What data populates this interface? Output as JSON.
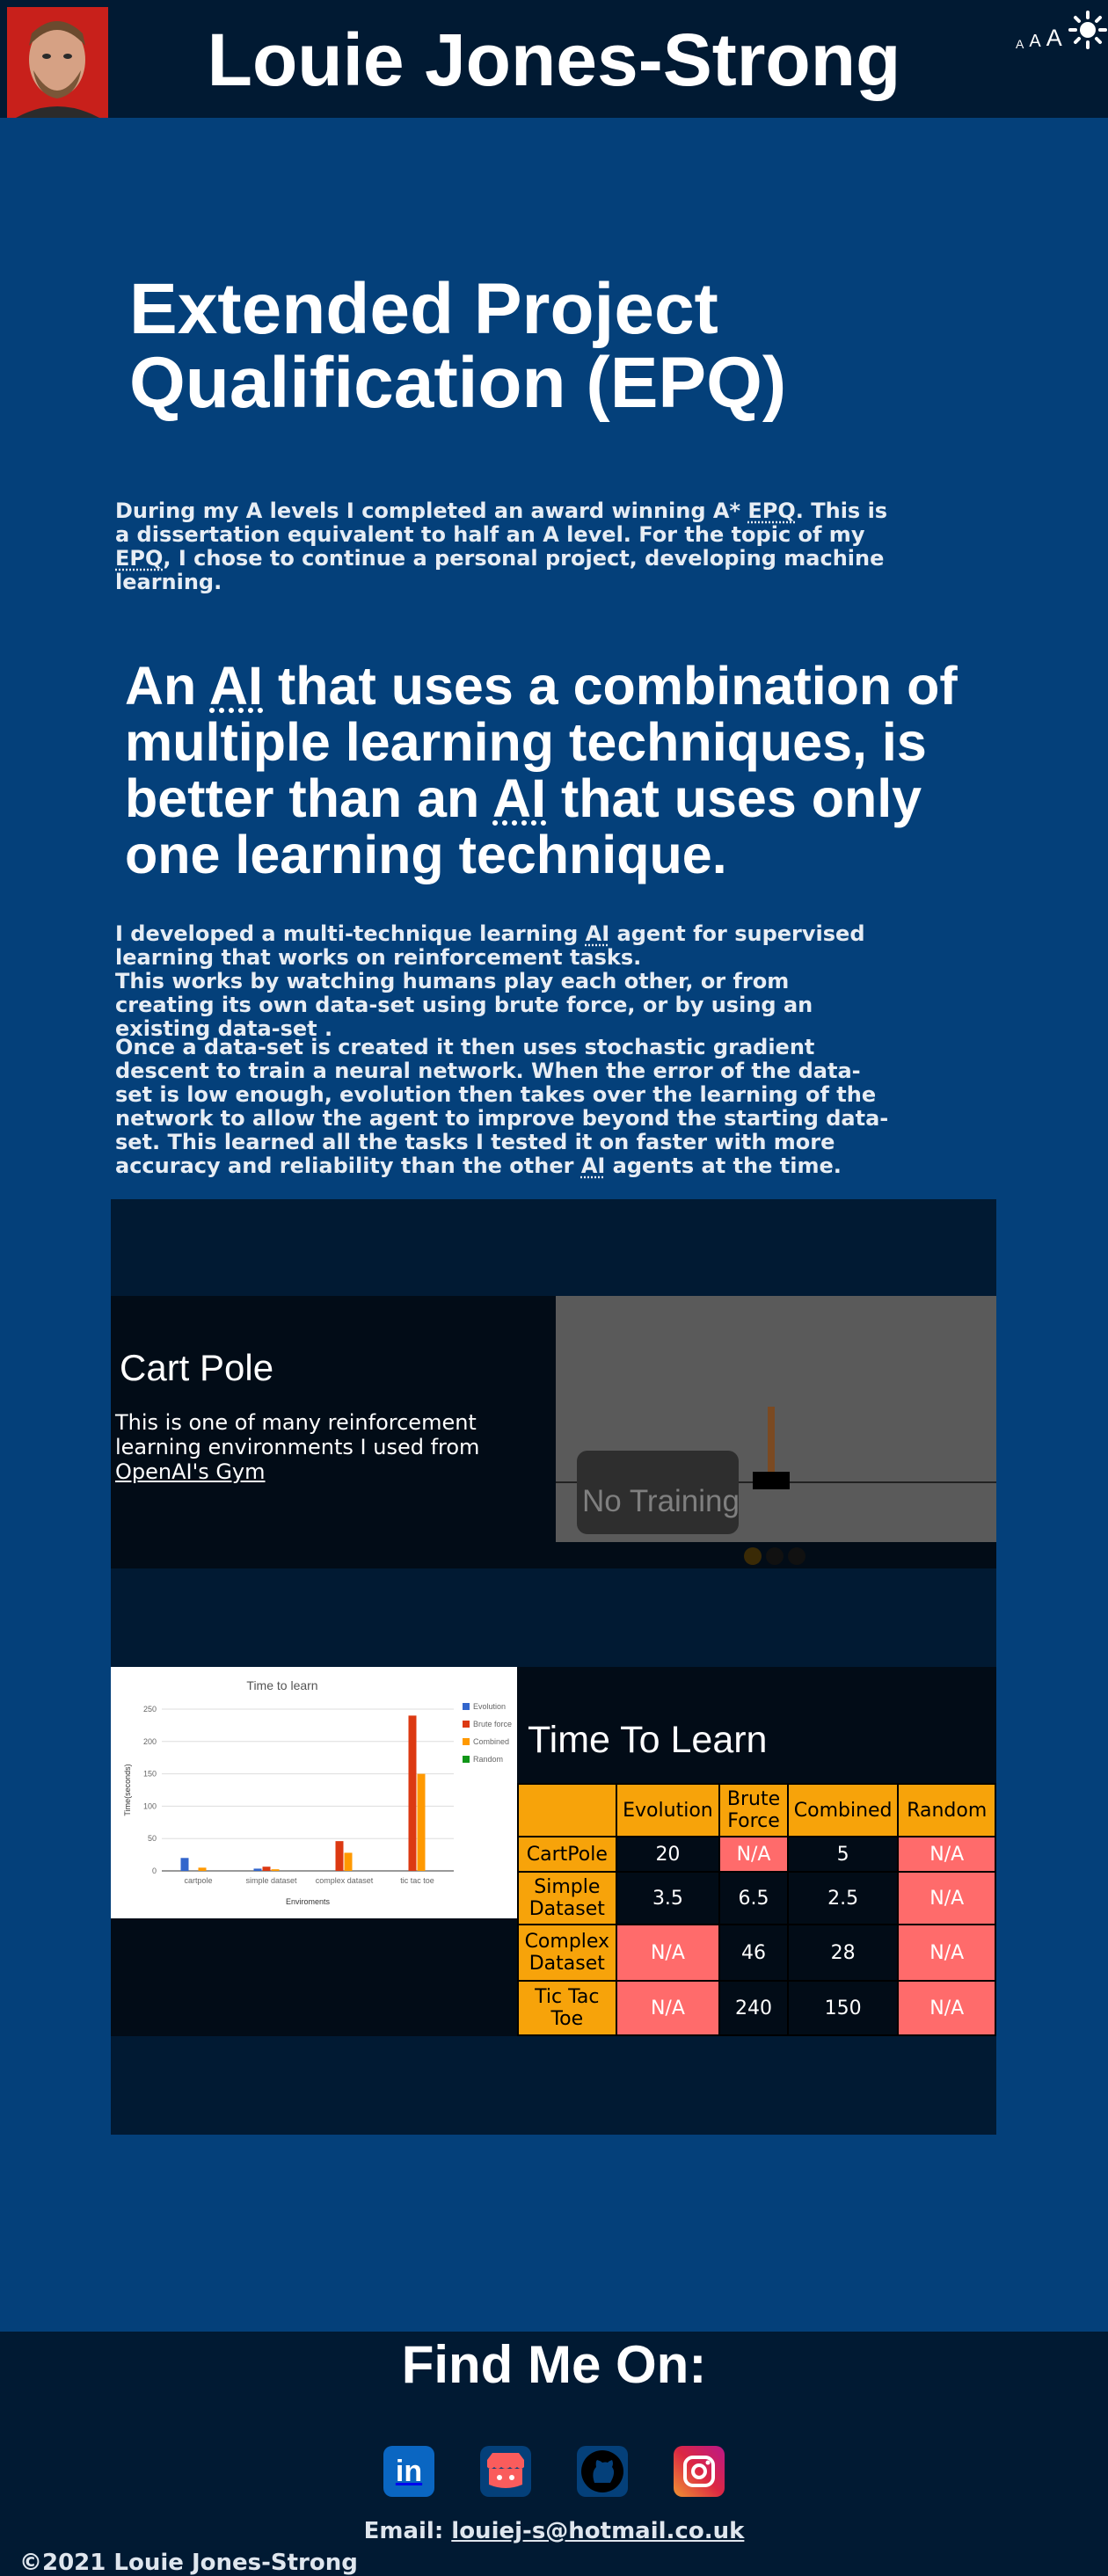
{
  "header": {
    "title": "Louie Jones-Strong",
    "font_controls": [
      "A",
      "A",
      "A"
    ]
  },
  "intro": {
    "title": "Extended Project Qualification (EPQ)",
    "paragraph_parts": [
      "During my A levels I completed an award winning A* ",
      "EPQ",
      ". This is a dissertation equivalent to half an A level. For the topic of my ",
      "EPQ",
      ", I chose to continue a personal project, developing machine learning."
    ]
  },
  "thesis": {
    "parts": [
      "An ",
      "AI",
      " that uses a combination of multiple learning techniques, is better than an ",
      "AI",
      " that uses only one learning technique."
    ]
  },
  "description": {
    "p1_parts": [
      "I developed a multi-technique learning ",
      "AI",
      " agent for supervised learning that works on reinforcement tasks."
    ],
    "p1_line2": "This works by watching humans play each other, or from creating its own data-set using brute force, or by using an existing data-set .",
    "p2_parts": [
      "Once a data-set is created it then uses stochastic gradient descent to train a neural network. When the error of the data-set is low enough, evolution then takes over the learning of the network to allow the agent to improve beyond the starting data-set. This learned all the tasks I tested it on faster with more accuracy and reliability than the other ",
      "AI",
      " agents at the time."
    ]
  },
  "cart_pole": {
    "title": "Cart Pole",
    "text": "This is one of many reinforcement learning environments I used from ",
    "link_text": "OpenAI's Gym",
    "badge": "No Training"
  },
  "time_to_learn": {
    "title": "Time To Learn",
    "table": {
      "headers": [
        "",
        "Evolution",
        "Brute Force",
        "Combined",
        "Random"
      ],
      "rows": [
        {
          "name": "CartPole",
          "cells": [
            "20",
            "N/A",
            "5",
            "N/A"
          ]
        },
        {
          "name": "Simple Dataset",
          "cells": [
            "3.5",
            "6.5",
            "2.5",
            "N/A"
          ]
        },
        {
          "name": "Complex Dataset",
          "cells": [
            "N/A",
            "46",
            "28",
            "N/A"
          ]
        },
        {
          "name": "Tic Tac Toe",
          "cells": [
            "N/A",
            "240",
            "150",
            "N/A"
          ]
        }
      ]
    }
  },
  "chart_data": {
    "type": "bar",
    "title": "Time to learn",
    "xlabel": "Enviroments",
    "ylabel": "Time(seconds)",
    "categories": [
      "cartpole",
      "simple dataset",
      "complex dataset",
      "tic tac toe"
    ],
    "series": [
      {
        "name": "Evolution",
        "color": "#3366cc",
        "values": [
          20,
          3.5,
          0,
          0
        ]
      },
      {
        "name": "Brute force",
        "color": "#dc3912",
        "values": [
          0,
          6.5,
          46,
          240
        ]
      },
      {
        "name": "Combined",
        "color": "#ff9900",
        "values": [
          5,
          2.5,
          28,
          150
        ]
      },
      {
        "name": "Random",
        "color": "#109618",
        "values": [
          0,
          0,
          0,
          0
        ]
      }
    ],
    "yticks": [
      0,
      50,
      100,
      150,
      200,
      250
    ],
    "ylim": [
      0,
      250
    ],
    "grid": true,
    "legend": "right"
  },
  "footer": {
    "title": "Find Me On:",
    "socials": [
      {
        "name": "linkedin-icon",
        "label": "in",
        "color": "#0a66c2"
      },
      {
        "name": "itch-icon",
        "label": "",
        "color": "#fa5c5c"
      },
      {
        "name": "github-icon",
        "label": "",
        "color": "#000000"
      },
      {
        "name": "instagram-icon",
        "label": "",
        "color": "#d6249f"
      }
    ],
    "email_label": "Email: ",
    "email": "louiej-s@hotmail.co.uk",
    "copyright": "©2021 Louie Jones-Strong"
  }
}
